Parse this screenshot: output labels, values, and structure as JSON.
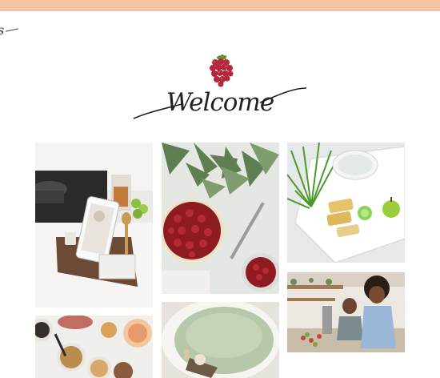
{
  "header": {
    "corner_logo": "s",
    "welcome_text": "Welcome",
    "icon": "raspberry-icon"
  },
  "gallery": {
    "tiles": [
      {
        "name": "kitchen-tablet-photo"
      },
      {
        "name": "berry-tart-photo"
      },
      {
        "name": "herb-tray-photo"
      },
      {
        "name": "breakfast-bowls-photo"
      },
      {
        "name": "bath-tub-photo"
      },
      {
        "name": "women-cooking-photo"
      }
    ]
  },
  "colors": {
    "topbar": "#f7c2a6",
    "accent_berry": "#b5283b"
  }
}
